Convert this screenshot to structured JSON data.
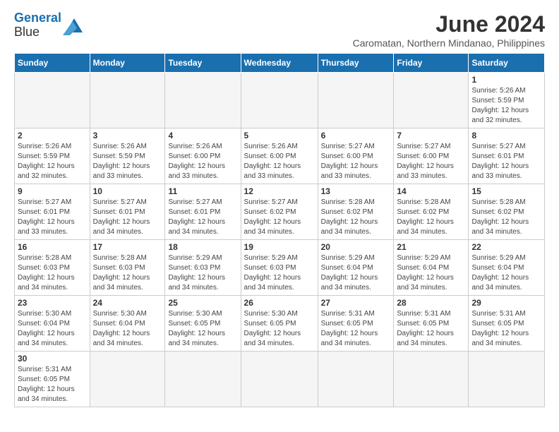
{
  "logo": {
    "text_general": "General",
    "text_blue": "Blue"
  },
  "header": {
    "month_year": "June 2024",
    "location": "Caromatan, Northern Mindanao, Philippines"
  },
  "weekdays": [
    "Sunday",
    "Monday",
    "Tuesday",
    "Wednesday",
    "Thursday",
    "Friday",
    "Saturday"
  ],
  "weeks": [
    [
      {
        "day": "",
        "empty": true
      },
      {
        "day": "",
        "empty": true
      },
      {
        "day": "",
        "empty": true
      },
      {
        "day": "",
        "empty": true
      },
      {
        "day": "",
        "empty": true
      },
      {
        "day": "",
        "empty": true
      },
      {
        "day": "1",
        "sunrise": "5:26 AM",
        "sunset": "5:59 PM",
        "daylight": "12 hours and 32 minutes."
      }
    ],
    [
      {
        "day": "2",
        "sunrise": "5:26 AM",
        "sunset": "5:59 PM",
        "daylight": "12 hours and 32 minutes."
      },
      {
        "day": "3",
        "sunrise": "5:26 AM",
        "sunset": "5:59 PM",
        "daylight": "12 hours and 33 minutes."
      },
      {
        "day": "4",
        "sunrise": "5:26 AM",
        "sunset": "6:00 PM",
        "daylight": "12 hours and 33 minutes."
      },
      {
        "day": "5",
        "sunrise": "5:26 AM",
        "sunset": "6:00 PM",
        "daylight": "12 hours and 33 minutes."
      },
      {
        "day": "6",
        "sunrise": "5:27 AM",
        "sunset": "6:00 PM",
        "daylight": "12 hours and 33 minutes."
      },
      {
        "day": "7",
        "sunrise": "5:27 AM",
        "sunset": "6:00 PM",
        "daylight": "12 hours and 33 minutes."
      },
      {
        "day": "8",
        "sunrise": "5:27 AM",
        "sunset": "6:01 PM",
        "daylight": "12 hours and 33 minutes."
      }
    ],
    [
      {
        "day": "9",
        "sunrise": "5:27 AM",
        "sunset": "6:01 PM",
        "daylight": "12 hours and 33 minutes."
      },
      {
        "day": "10",
        "sunrise": "5:27 AM",
        "sunset": "6:01 PM",
        "daylight": "12 hours and 34 minutes."
      },
      {
        "day": "11",
        "sunrise": "5:27 AM",
        "sunset": "6:01 PM",
        "daylight": "12 hours and 34 minutes."
      },
      {
        "day": "12",
        "sunrise": "5:27 AM",
        "sunset": "6:02 PM",
        "daylight": "12 hours and 34 minutes."
      },
      {
        "day": "13",
        "sunrise": "5:28 AM",
        "sunset": "6:02 PM",
        "daylight": "12 hours and 34 minutes."
      },
      {
        "day": "14",
        "sunrise": "5:28 AM",
        "sunset": "6:02 PM",
        "daylight": "12 hours and 34 minutes."
      },
      {
        "day": "15",
        "sunrise": "5:28 AM",
        "sunset": "6:02 PM",
        "daylight": "12 hours and 34 minutes."
      }
    ],
    [
      {
        "day": "16",
        "sunrise": "5:28 AM",
        "sunset": "6:03 PM",
        "daylight": "12 hours and 34 minutes."
      },
      {
        "day": "17",
        "sunrise": "5:28 AM",
        "sunset": "6:03 PM",
        "daylight": "12 hours and 34 minutes."
      },
      {
        "day": "18",
        "sunrise": "5:29 AM",
        "sunset": "6:03 PM",
        "daylight": "12 hours and 34 minutes."
      },
      {
        "day": "19",
        "sunrise": "5:29 AM",
        "sunset": "6:03 PM",
        "daylight": "12 hours and 34 minutes."
      },
      {
        "day": "20",
        "sunrise": "5:29 AM",
        "sunset": "6:04 PM",
        "daylight": "12 hours and 34 minutes."
      },
      {
        "day": "21",
        "sunrise": "5:29 AM",
        "sunset": "6:04 PM",
        "daylight": "12 hours and 34 minutes."
      },
      {
        "day": "22",
        "sunrise": "5:29 AM",
        "sunset": "6:04 PM",
        "daylight": "12 hours and 34 minutes."
      }
    ],
    [
      {
        "day": "23",
        "sunrise": "5:30 AM",
        "sunset": "6:04 PM",
        "daylight": "12 hours and 34 minutes."
      },
      {
        "day": "24",
        "sunrise": "5:30 AM",
        "sunset": "6:04 PM",
        "daylight": "12 hours and 34 minutes."
      },
      {
        "day": "25",
        "sunrise": "5:30 AM",
        "sunset": "6:05 PM",
        "daylight": "12 hours and 34 minutes."
      },
      {
        "day": "26",
        "sunrise": "5:30 AM",
        "sunset": "6:05 PM",
        "daylight": "12 hours and 34 minutes."
      },
      {
        "day": "27",
        "sunrise": "5:31 AM",
        "sunset": "6:05 PM",
        "daylight": "12 hours and 34 minutes."
      },
      {
        "day": "28",
        "sunrise": "5:31 AM",
        "sunset": "6:05 PM",
        "daylight": "12 hours and 34 minutes."
      },
      {
        "day": "29",
        "sunrise": "5:31 AM",
        "sunset": "6:05 PM",
        "daylight": "12 hours and 34 minutes."
      }
    ],
    [
      {
        "day": "30",
        "sunrise": "5:31 AM",
        "sunset": "6:05 PM",
        "daylight": "12 hours and 34 minutes."
      },
      {
        "day": "",
        "empty": true
      },
      {
        "day": "",
        "empty": true
      },
      {
        "day": "",
        "empty": true
      },
      {
        "day": "",
        "empty": true
      },
      {
        "day": "",
        "empty": true
      },
      {
        "day": "",
        "empty": true
      }
    ]
  ]
}
